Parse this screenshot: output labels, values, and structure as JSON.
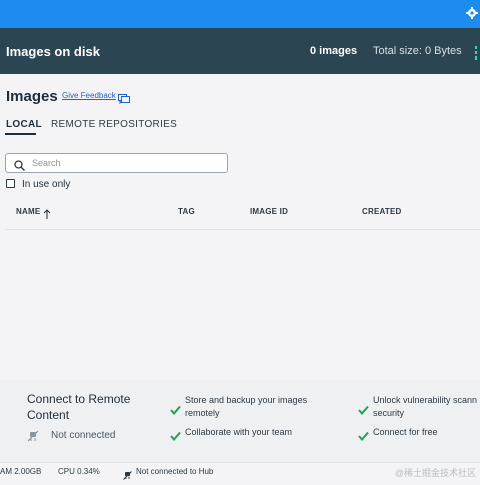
{
  "topbar": {
    "icon": "gear-icon",
    "color": "#1d8bf0"
  },
  "disk": {
    "title": "Images on disk",
    "count": "0 images",
    "total_size": "Total size: 0 Bytes",
    "color": "#2c4553"
  },
  "page": {
    "title": "Images",
    "feedback_label": "Give Feedback",
    "feedback_icon": "chat-icon"
  },
  "tabs": [
    {
      "label": "LOCAL",
      "active": true
    },
    {
      "label": "REMOTE REPOSITORIES",
      "active": false
    }
  ],
  "search": {
    "placeholder": "Search",
    "value": ""
  },
  "filter": {
    "in_use_only_label": "In use only",
    "checked": false
  },
  "table": {
    "columns": [
      "NAME",
      "TAG",
      "IMAGE ID",
      "CREATED"
    ],
    "sort_column": "NAME",
    "sort_icon": "arrow-up-icon",
    "rows": []
  },
  "remote": {
    "title": "Connect to Remote Content",
    "status": "Not connected",
    "features": [
      "Store and backup your images remotely",
      "Collaborate with your team",
      "Unlock vulnerability scann security",
      "Connect for free"
    ],
    "check_color": "#20a34a"
  },
  "statusbar": {
    "ram": "AM 2.00GB",
    "cpu": "CPU 0.34%",
    "hub": "Not connected to Hub",
    "watermark": "@稀土掘金技术社区"
  }
}
